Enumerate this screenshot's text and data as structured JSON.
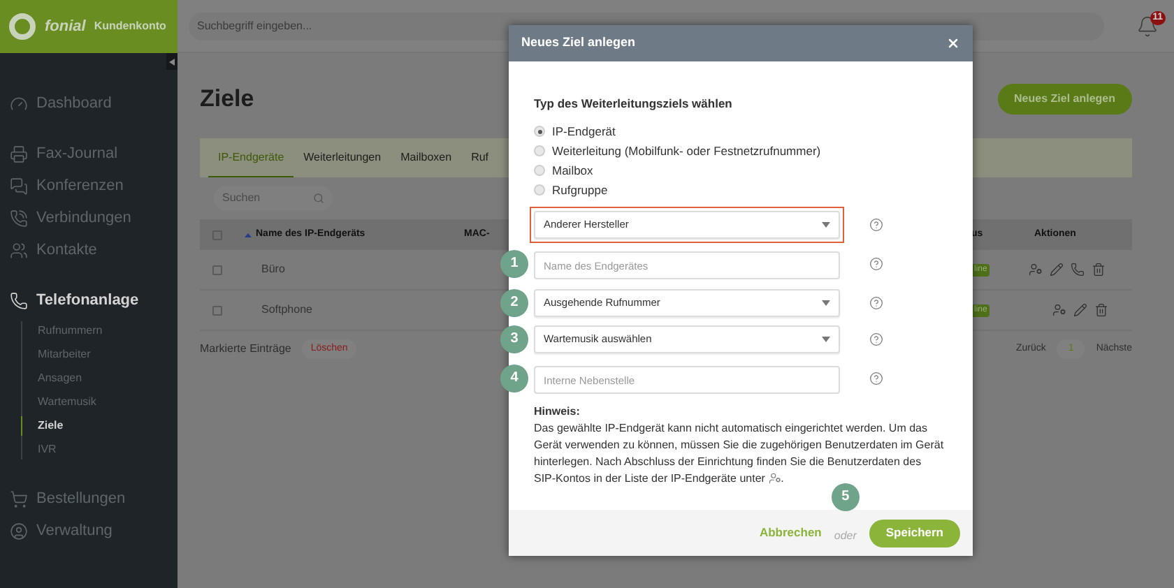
{
  "brand": {
    "name": "fonial",
    "product": "Kundenkonto"
  },
  "header": {
    "search_placeholder": "Suchbegriff eingeben...",
    "notification_count": "11"
  },
  "sidebar": {
    "sections": [
      {
        "items": [
          {
            "label": "Dashboard",
            "expanded": false
          }
        ]
      },
      {
        "items": [
          {
            "label": "Fax-Journal",
            "expanded": false
          },
          {
            "label": "Konferenzen",
            "expanded": false
          },
          {
            "label": "Verbindungen",
            "expanded": false
          },
          {
            "label": "Kontakte",
            "expanded": false
          }
        ]
      },
      {
        "items": [
          {
            "label": "Telefonanlage",
            "expanded": true,
            "children": [
              {
                "label": "Rufnummern",
                "selected": false
              },
              {
                "label": "Mitarbeiter",
                "selected": false
              },
              {
                "label": "Ansagen",
                "selected": false
              },
              {
                "label": "Wartemusik",
                "selected": false
              },
              {
                "label": "Ziele",
                "selected": true
              },
              {
                "label": "IVR",
                "selected": false
              }
            ]
          }
        ]
      },
      {
        "items": [
          {
            "label": "Bestellungen",
            "expanded": false
          },
          {
            "label": "Verwaltung",
            "expanded": false
          }
        ]
      }
    ]
  },
  "page": {
    "title": "Ziele",
    "new_button": "Neues Ziel anlegen"
  },
  "tabs": [
    {
      "label": "IP-Endgeräte",
      "selected": true
    },
    {
      "label": "Weiterleitungen",
      "selected": false
    },
    {
      "label": "Mailboxen",
      "selected": false
    },
    {
      "label": "Ruf",
      "selected": false
    }
  ],
  "table_search": {
    "placeholder": "Suchen"
  },
  "table": {
    "all_checked": false,
    "columns": [
      "Name des IP-Endgeräts",
      "MAC-",
      "us",
      "Aktionen"
    ],
    "rows": [
      {
        "checked": false,
        "name": "Büro",
        "status": "line",
        "has_phone_action": true
      },
      {
        "checked": false,
        "name": "Softphone",
        "status": "line",
        "has_phone_action": false
      }
    ]
  },
  "bulk": {
    "label": "Markierte Einträge",
    "delete": "Löschen"
  },
  "pagination": {
    "previous": "Zurück",
    "page": "1",
    "next": "Nächste"
  },
  "dialog": {
    "title": "Neues Ziel anlegen",
    "type_label": "Typ des Weiterleitungsziels wählen",
    "types": [
      {
        "label": "IP-Endgerät",
        "selected": true
      },
      {
        "label": "Weiterleitung (Mobilfunk- oder Festnetzrufnummer)",
        "selected": false
      },
      {
        "label": "Mailbox",
        "selected": false
      },
      {
        "label": "Rufgruppe",
        "selected": false
      }
    ],
    "fields": [
      {
        "kind": "select",
        "value": "Anderer Hersteller",
        "highlighted": true
      },
      {
        "kind": "input",
        "placeholder": "Name des Endgerätes",
        "step": "1",
        "highlighted": false
      },
      {
        "kind": "select",
        "value": "Ausgehende Rufnummer",
        "step": "2",
        "highlighted": false
      },
      {
        "kind": "select",
        "value": "Wartemusik auswählen",
        "step": "3",
        "highlighted": false
      },
      {
        "kind": "input",
        "placeholder": "Interne Nebenstelle",
        "step": "4",
        "highlighted": false
      }
    ],
    "hint_title": "Hinweis:",
    "hint_text": "Das gewählte IP-Endgerät kann nicht automatisch eingerichtet werden. Um das Gerät verwenden zu können, müssen Sie die zugehörigen Benutzerdaten im Gerät hinterlegen. Nach Abschluss der Einrichtung finden Sie die Benutzerdaten des SIP-Kontos in der Liste der IP-Endgeräte unter",
    "hint_end": ".",
    "cancel": "Abbrechen",
    "or": "oder",
    "or_step": "5",
    "save": "Speichern"
  }
}
